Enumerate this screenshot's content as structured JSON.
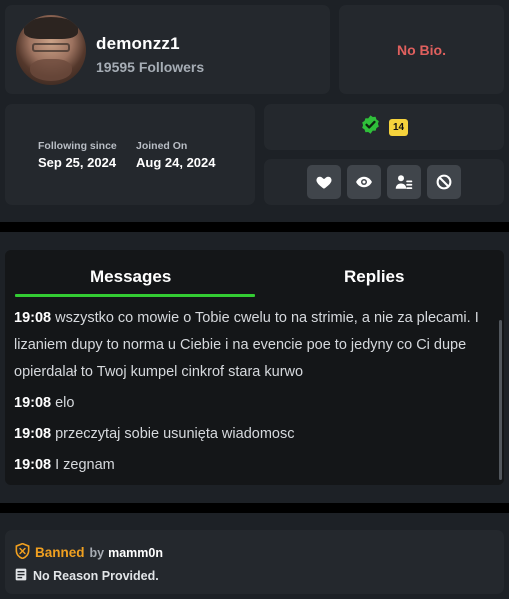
{
  "profile": {
    "username": "demonzz1",
    "followers": "19595 Followers"
  },
  "bio": {
    "text": "No Bio."
  },
  "dates": {
    "following_label": "Following since",
    "following_value": "Sep 25, 2024",
    "joined_label": "Joined On",
    "joined_value": "Aug 24, 2024"
  },
  "badges": {
    "verified_icon": "verified-check-icon",
    "verified_color": "#2fbf3a",
    "age_badge": "14",
    "age_badge_color": "#f5d33c"
  },
  "actions": [
    {
      "icon": "heart-icon"
    },
    {
      "icon": "eye-icon"
    },
    {
      "icon": "user-card-icon"
    },
    {
      "icon": "block-icon"
    }
  ],
  "tabs": {
    "messages": "Messages",
    "replies": "Replies",
    "active_color": "#33cc33"
  },
  "messages": [
    {
      "time": "19:08",
      "text": "wszystko co mowie o Tobie cwelu to na strimie, a nie za plecami. I lizaniem dupy to norma u Ciebie i na evencie poe to jedyny co Ci dupe opierdalał to Twoj kumpel cinkrof stara kurwo"
    },
    {
      "time": "19:08",
      "text": "elo"
    },
    {
      "time": "19:08",
      "text": "przeczytaj sobie usunięta wiadomosc"
    },
    {
      "time": "19:08",
      "text": "I zegnam"
    }
  ],
  "ban": {
    "status": "Banned",
    "by_label": "by",
    "by_user": "mamm0n",
    "reason": "No Reason Provided.",
    "status_color": "#f0a020"
  }
}
